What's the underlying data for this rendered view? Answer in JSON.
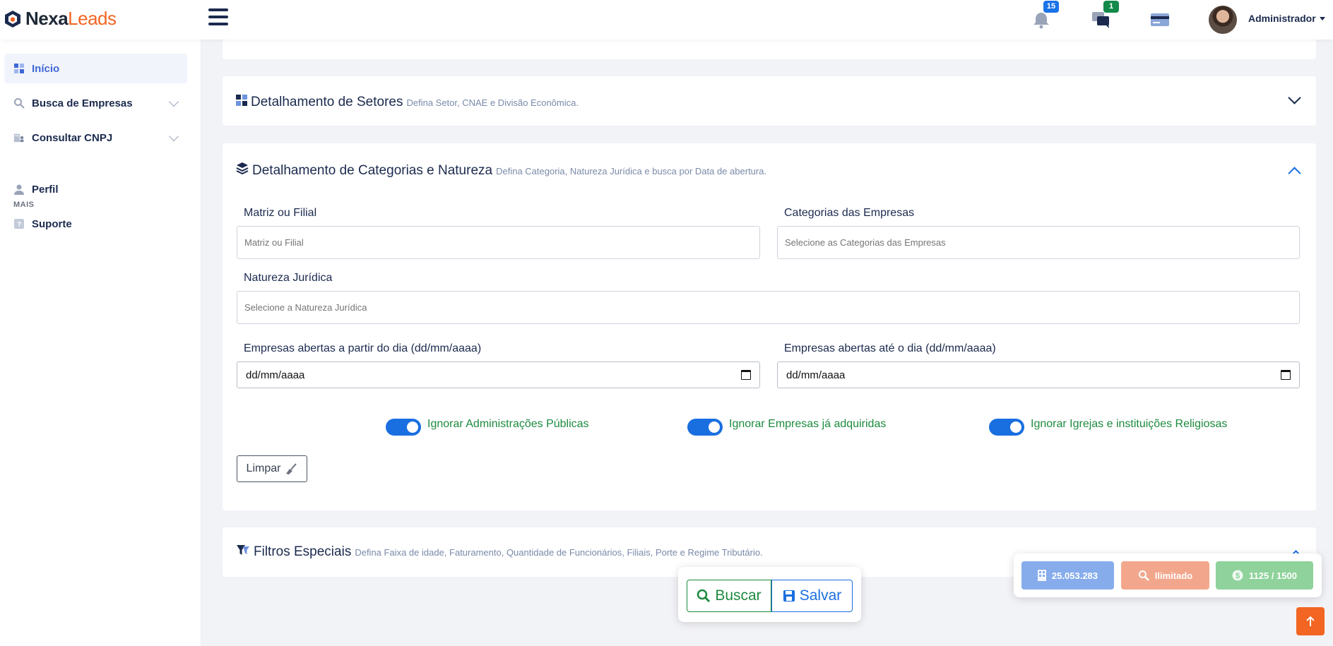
{
  "brand": {
    "name_part1": "Nexa",
    "name_part2": "Leads"
  },
  "topbar": {
    "notifications_count": "15",
    "messages_count": "1",
    "user_name": "Administrador"
  },
  "sidebar": {
    "items": [
      {
        "label": "Início"
      },
      {
        "label": "Busca de Empresas"
      },
      {
        "label": "Consultar CNPJ"
      }
    ],
    "section_label": "MAIS",
    "extra_items": [
      {
        "label": "Perfil"
      },
      {
        "label": "Suporte"
      }
    ]
  },
  "sections": {
    "setores": {
      "title": "Detalhamento de Setores",
      "subtitle": "Defina Setor, CNAE e Divisão Econômica."
    },
    "categorias": {
      "title": "Detalhamento de Categorias e Natureza",
      "subtitle": "Defina Categoria, Natureza Jurídica e busca por Data de abertura."
    },
    "especiais": {
      "title": "Filtros Especiais",
      "subtitle": "Defina Faixa de idade, Faturamento, Quantidade de Funcionários, Filiais, Porte e Regime Tributário."
    }
  },
  "form": {
    "matriz": {
      "label": "Matriz ou Filial",
      "placeholder": "Matriz ou Filial"
    },
    "categorias": {
      "label": "Categorias das Empresas",
      "placeholder": "Selecione as Categorias das Empresas"
    },
    "natureza": {
      "label": "Natureza Jurídica",
      "placeholder": "Selecione a Natureza Jurídica"
    },
    "data_inicio": {
      "label": "Empresas abertas a partir do dia (dd/mm/aaaa)",
      "value": "dd/mm/aaaa"
    },
    "data_fim": {
      "label": "Empresas abertas até o dia (dd/mm/aaaa)",
      "value": "dd/mm/aaaa"
    },
    "switches": [
      {
        "label": "Ignorar Administrações Públicas",
        "on": true
      },
      {
        "label": "Ignorar Empresas já adquiridas",
        "on": true
      },
      {
        "label": "Ignorar Igrejas e instituições Religiosas",
        "on": true
      }
    ],
    "clear_label": "Limpar"
  },
  "actions": {
    "search_label": "Buscar",
    "save_label": "Salvar"
  },
  "stats": {
    "companies": "25.053.283",
    "searches": "Ilimitado",
    "credits": "1125 / 1500"
  },
  "colors": {
    "brand_orange": "#f26522",
    "navy": "#1b2a4e",
    "primary_blue": "#1a6fe0",
    "success_green": "#1d8a3f"
  }
}
